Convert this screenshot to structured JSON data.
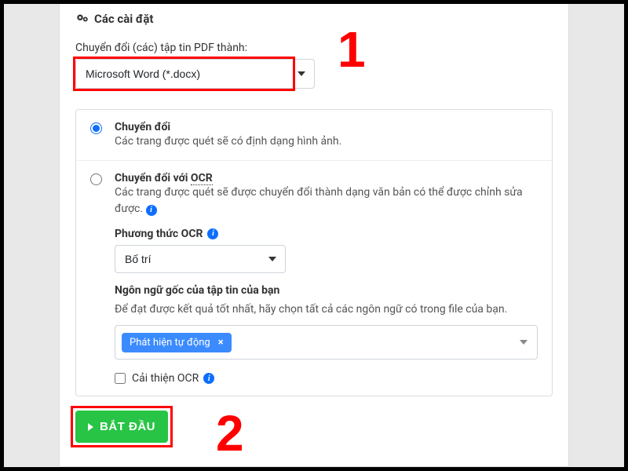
{
  "header": {
    "title": "Các cài đặt"
  },
  "convert": {
    "label": "Chuyển đổi (các) tập tin PDF thành:",
    "selected": "Microsoft Word (*.docx)"
  },
  "options": {
    "simple": {
      "title": "Chuyển đổi",
      "desc": "Các trang được quét sẽ có định dạng hình ảnh."
    },
    "ocr": {
      "title_prefix": "Chuyển đổi với ",
      "title_ocr": "OCR",
      "desc": "Các trang được quét sẽ được chuyển đổi thành dạng văn bản có thể được chỉnh sửa được.",
      "method_label": "Phương thức OCR",
      "method_selected": "Bố trí",
      "lang_label": "Ngôn ngữ gốc của tập tin của bạn",
      "lang_hint": "Để đạt được kết quả tốt nhất, hãy chọn tất cả các ngôn ngữ có trong file của bạn.",
      "lang_chip": "Phát hiện tự động",
      "improve_label": "Cải thiện OCR"
    }
  },
  "start": {
    "label": "BẮT ĐẦU"
  },
  "annotations": {
    "one": "1",
    "two": "2"
  }
}
